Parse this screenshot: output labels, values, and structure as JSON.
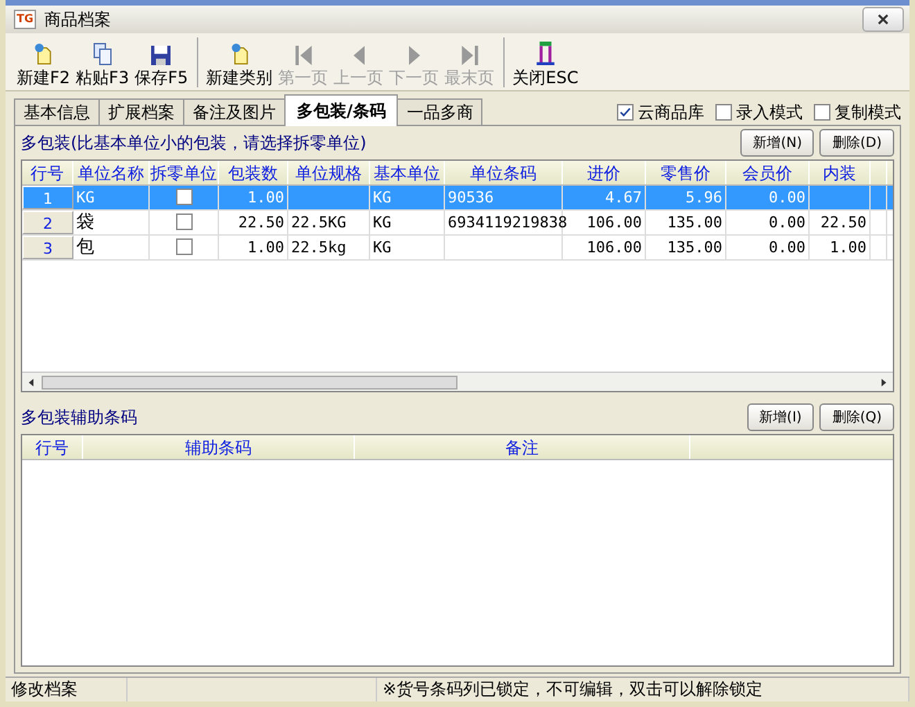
{
  "window": {
    "title": "商品档案",
    "logo": "TG"
  },
  "toolbar": [
    {
      "label": "新建F2",
      "disabled": false
    },
    {
      "label": "粘贴F3",
      "disabled": false
    },
    {
      "label": "保存F5",
      "disabled": false
    },
    {
      "label": "新建类别",
      "disabled": false
    },
    {
      "label": "第一页",
      "disabled": true
    },
    {
      "label": "上一页",
      "disabled": true
    },
    {
      "label": "下一页",
      "disabled": true
    },
    {
      "label": "最末页",
      "disabled": true
    },
    {
      "label": "关闭ESC",
      "disabled": false
    }
  ],
  "tabs": [
    {
      "label": "基本信息",
      "selected": false
    },
    {
      "label": "扩展档案",
      "selected": false
    },
    {
      "label": "备注及图片",
      "selected": false
    },
    {
      "label": "多包装/条码",
      "selected": true
    },
    {
      "label": "一品多商",
      "selected": false
    }
  ],
  "options": [
    {
      "label": "云商品库",
      "checked": true
    },
    {
      "label": "录入模式",
      "checked": false
    },
    {
      "label": "复制模式",
      "checked": false
    }
  ],
  "packages": {
    "title": "多包装(比基本单位小的包装，请选择拆零单位)",
    "buttons": [
      "新增(N)",
      "删除(D)"
    ],
    "columns": [
      "行号",
      "单位名称",
      "拆零单位",
      "包装数",
      "单位规格",
      "基本单位",
      "单位条码",
      "进价",
      "零售价",
      "会员价",
      "内装"
    ],
    "rows": [
      {
        "no": "1",
        "unit": "KG",
        "split": false,
        "qty": "1.00",
        "spec": "",
        "base": "KG",
        "barcode": "90536",
        "cost": "4.67",
        "retail": "5.96",
        "member": "0.00",
        "inner": "",
        "selected": true
      },
      {
        "no": "2",
        "unit": "袋",
        "split": false,
        "qty": "22.50",
        "spec": "22.5KG",
        "base": "KG",
        "barcode": "6934119219838",
        "cost": "106.00",
        "retail": "135.00",
        "member": "0.00",
        "inner": "22.50",
        "selected": false
      },
      {
        "no": "3",
        "unit": "包",
        "split": false,
        "qty": "1.00",
        "spec": "22.5kg",
        "base": "KG",
        "barcode": "",
        "cost": "106.00",
        "retail": "135.00",
        "member": "0.00",
        "inner": "1.00",
        "selected": false
      }
    ]
  },
  "aux_barcodes": {
    "title": "多包装辅助条码",
    "buttons": [
      "新增(I)",
      "删除(Q)"
    ],
    "columns": [
      "行号",
      "辅助条码",
      "备注"
    ]
  },
  "status_bar": [
    "修改档案",
    "※货号条码列已锁定，不可编辑，双击可以解除锁定"
  ]
}
